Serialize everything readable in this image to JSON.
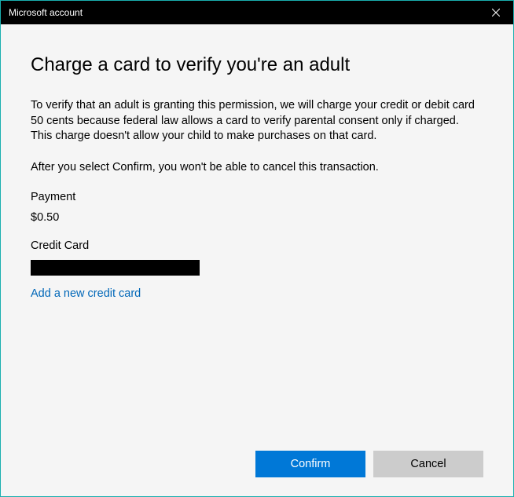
{
  "titlebar": {
    "title": "Microsoft account"
  },
  "heading": "Charge a card to verify you're an adult",
  "description": "To verify that an adult is granting this permission, we will charge your credit or debit card 50 cents because federal law allows a card to verify parental consent only if charged. This charge doesn't allow your child to make purchases on that card.",
  "notice": "After you select Confirm, you won't be able to cancel this transaction.",
  "payment": {
    "label": "Payment",
    "amount": "$0.50",
    "method_label": "Credit Card"
  },
  "add_card_link": "Add a new credit card",
  "buttons": {
    "confirm": "Confirm",
    "cancel": "Cancel"
  }
}
